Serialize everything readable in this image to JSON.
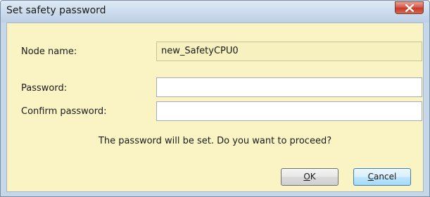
{
  "dialog": {
    "title": "Set safety password",
    "close_icon": "close-x-icon"
  },
  "form": {
    "node_name_label": "Node name:",
    "node_name_value": "new_SafetyCPU0",
    "password_label": "Password:",
    "password_value": "",
    "confirm_label": "Confirm password:",
    "confirm_value": ""
  },
  "message": "The password will be set. Do you want to proceed?",
  "buttons": {
    "ok_mnemonic": "O",
    "ok_rest": "K",
    "cancel_mnemonic": "C",
    "cancel_rest": "ancel"
  },
  "colors": {
    "client_background": "#faf4c4",
    "frame": "#c6d7ea",
    "close_button": "#c33b2b"
  }
}
